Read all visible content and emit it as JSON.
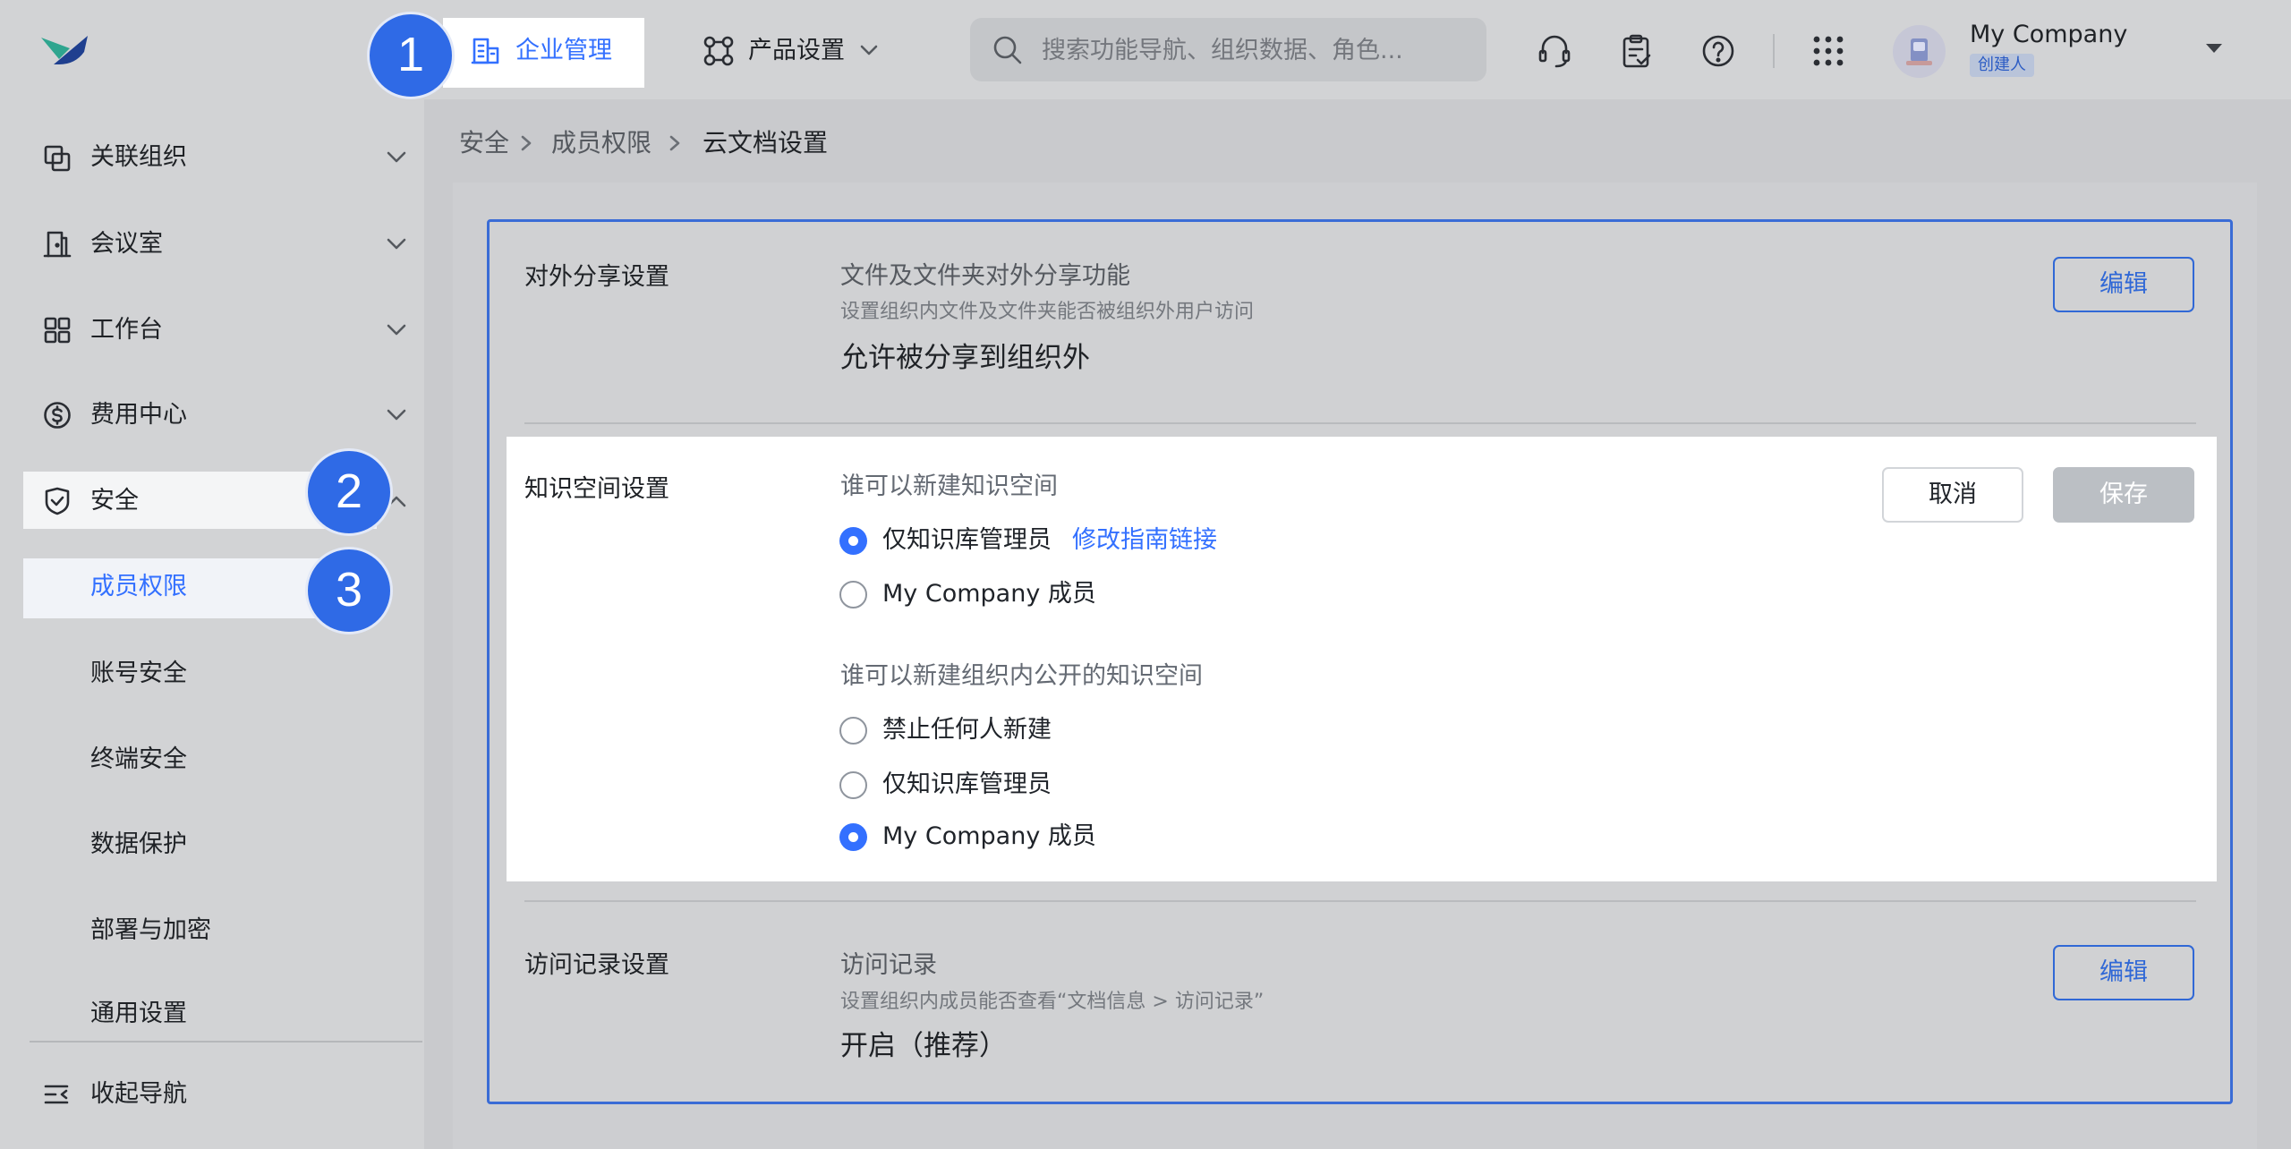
{
  "colors": {
    "accent": "#3370ff",
    "badge": "#2f6ae6",
    "card_border": "#3a6cd6",
    "save_disabled": "#bbbfc4"
  },
  "header": {
    "logo_icon": "app-logo",
    "nav": [
      {
        "label": "企业管理",
        "icon": "building-icon",
        "active": true
      },
      {
        "label": "产品设置",
        "icon": "product-settings-icon",
        "has_dropdown": true
      }
    ],
    "search": {
      "placeholder": "搜索功能导航、组织数据、角色..."
    },
    "actions": [
      {
        "icon": "headset-icon"
      },
      {
        "icon": "clipboard-check-icon"
      },
      {
        "icon": "help-icon"
      },
      {
        "icon": "app-grid-icon"
      }
    ],
    "account": {
      "name": "My Company",
      "role": "创建人"
    }
  },
  "step_badges": [
    "1",
    "2",
    "3"
  ],
  "sidebar": {
    "items": [
      {
        "label": "关联组织",
        "icon": "linked-org-icon",
        "expanded": false
      },
      {
        "label": "会议室",
        "icon": "meeting-room-icon",
        "expanded": false
      },
      {
        "label": "工作台",
        "icon": "workbench-icon",
        "expanded": false
      },
      {
        "label": "费用中心",
        "icon": "billing-icon",
        "expanded": false
      },
      {
        "label": "安全",
        "icon": "shield-icon",
        "expanded": true,
        "children": [
          {
            "label": "成员权限",
            "active": true
          },
          {
            "label": "账号安全"
          },
          {
            "label": "终端安全"
          },
          {
            "label": "数据保护"
          },
          {
            "label": "部署与加密"
          },
          {
            "label": "通用设置"
          }
        ]
      }
    ],
    "collapse_label": "收起导航"
  },
  "breadcrumb": [
    "安全",
    "成员权限",
    "云文档设置"
  ],
  "sections": [
    {
      "label": "对外分享设置",
      "title": "文件及文件夹对外分享功能",
      "description": "设置组织内文件及文件夹能否被组织外用户访问",
      "value": "允许被分享到组织外",
      "edit_label": "编辑"
    },
    {
      "label": "知识空间设置",
      "editing": true,
      "cancel_label": "取消",
      "save_label": "保存",
      "groups": [
        {
          "title": "谁可以新建知识空间",
          "options": [
            {
              "label": "仅知识库管理员",
              "checked": true,
              "link": "修改指南链接"
            },
            {
              "label": "My Company 成员",
              "checked": false
            }
          ]
        },
        {
          "title": "谁可以新建组织内公开的知识空间",
          "options": [
            {
              "label": "禁止任何人新建",
              "checked": false
            },
            {
              "label": "仅知识库管理员",
              "checked": false
            },
            {
              "label": "My Company 成员",
              "checked": true
            }
          ]
        }
      ]
    },
    {
      "label": "访问记录设置",
      "title": "访问记录",
      "description": "设置组织内成员能否查看“文档信息 > 访问记录”",
      "value": "开启（推荐）",
      "edit_label": "编辑"
    }
  ]
}
